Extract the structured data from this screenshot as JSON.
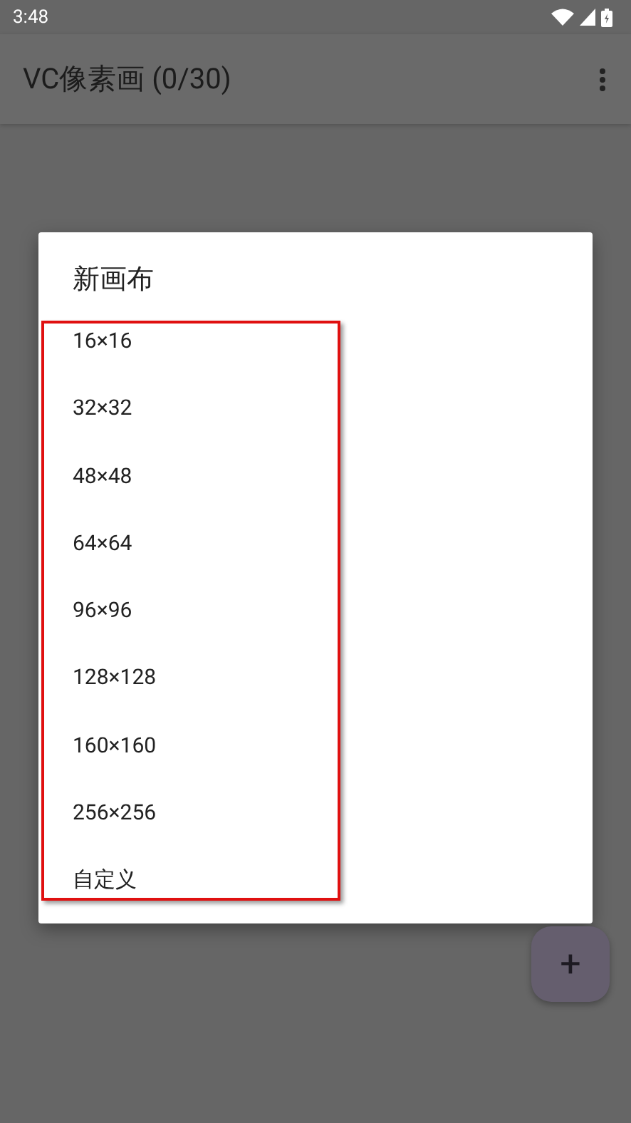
{
  "status_bar": {
    "time": "3:48"
  },
  "app_bar": {
    "title": "VC像素画 (0/30)"
  },
  "dialog": {
    "title": "新画布",
    "highlighted": true,
    "options": [
      {
        "label": "16×16"
      },
      {
        "label": "32×32"
      },
      {
        "label": "48×48"
      },
      {
        "label": "64×64"
      },
      {
        "label": "96×96"
      },
      {
        "label": "128×128"
      },
      {
        "label": "160×160"
      },
      {
        "label": "256×256"
      },
      {
        "label": "自定义"
      }
    ]
  },
  "fab": {
    "label": "+"
  }
}
